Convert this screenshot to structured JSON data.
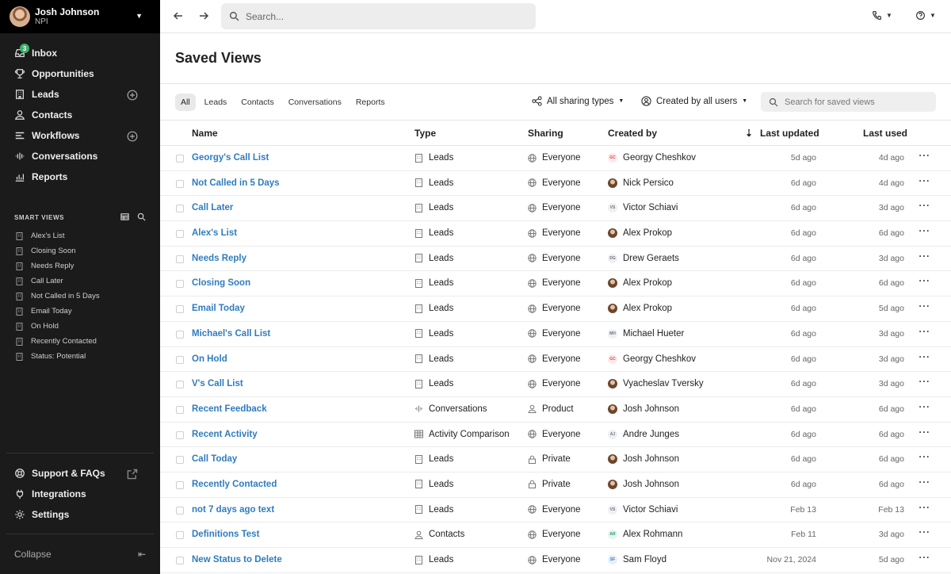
{
  "user": {
    "name": "Josh Johnson",
    "org": "NPI"
  },
  "nav": [
    {
      "label": "Inbox",
      "icon": "inbox-icon",
      "badge": "3"
    },
    {
      "label": "Opportunities",
      "icon": "trophy-icon"
    },
    {
      "label": "Leads",
      "icon": "building-icon"
    },
    {
      "label": "Contacts",
      "icon": "person-icon"
    },
    {
      "label": "Workflows",
      "icon": "workflow-icon"
    },
    {
      "label": "Conversations",
      "icon": "waveform-icon"
    },
    {
      "label": "Reports",
      "icon": "chart-icon"
    }
  ],
  "smart_views": {
    "heading": "SMART VIEWS",
    "items": [
      "Alex's List",
      "Closing Soon",
      "Needs Reply",
      "Call Later",
      "Not Called in 5 Days",
      "Email Today",
      "On Hold",
      "Recently Contacted",
      "Status: Potential"
    ]
  },
  "bottom_nav": [
    {
      "label": "Support & FAQs",
      "icon": "lifebuoy-icon"
    },
    {
      "label": "Integrations",
      "icon": "plug-icon"
    },
    {
      "label": "Settings",
      "icon": "gear-icon"
    }
  ],
  "collapse_label": "Collapse",
  "search": {
    "placeholder": "Search..."
  },
  "page_title": "Saved Views",
  "tabs": [
    "All",
    "Leads",
    "Contacts",
    "Conversations",
    "Reports"
  ],
  "filters": {
    "sharing": "All sharing types",
    "created_by": "Created by all users",
    "search_placeholder": "Search for saved views"
  },
  "columns": {
    "name": "Name",
    "type": "Type",
    "sharing": "Sharing",
    "created_by": "Created by",
    "last_updated": "Last updated",
    "last_used": "Last used"
  },
  "rows": [
    {
      "name": "Georgy's Call List",
      "type": "Leads",
      "sharing": "Everyone",
      "creator": "Georgy Cheshkov",
      "initials": "GC",
      "updated": "5d ago",
      "used": "4d ago"
    },
    {
      "name": "Not Called in 5 Days",
      "type": "Leads",
      "sharing": "Everyone",
      "creator": "Nick Persico",
      "initials": "",
      "updated": "6d ago",
      "used": "4d ago"
    },
    {
      "name": "Call Later",
      "type": "Leads",
      "sharing": "Everyone",
      "creator": "Victor Schiavi",
      "initials": "VS",
      "updated": "6d ago",
      "used": "3d ago"
    },
    {
      "name": "Alex's List",
      "type": "Leads",
      "sharing": "Everyone",
      "creator": "Alex Prokop",
      "initials": "",
      "updated": "6d ago",
      "used": "6d ago"
    },
    {
      "name": "Needs Reply",
      "type": "Leads",
      "sharing": "Everyone",
      "creator": "Drew Geraets",
      "initials": "DG",
      "updated": "6d ago",
      "used": "3d ago"
    },
    {
      "name": "Closing Soon",
      "type": "Leads",
      "sharing": "Everyone",
      "creator": "Alex Prokop",
      "initials": "",
      "updated": "6d ago",
      "used": "6d ago"
    },
    {
      "name": "Email Today",
      "type": "Leads",
      "sharing": "Everyone",
      "creator": "Alex Prokop",
      "initials": "",
      "updated": "6d ago",
      "used": "5d ago"
    },
    {
      "name": "Michael's Call List",
      "type": "Leads",
      "sharing": "Everyone",
      "creator": "Michael Hueter",
      "initials": "MH",
      "updated": "6d ago",
      "used": "3d ago"
    },
    {
      "name": "On Hold",
      "type": "Leads",
      "sharing": "Everyone",
      "creator": "Georgy Cheshkov",
      "initials": "GC",
      "updated": "6d ago",
      "used": "3d ago"
    },
    {
      "name": "V's Call List",
      "type": "Leads",
      "sharing": "Everyone",
      "creator": "Vyacheslav Tversky",
      "initials": "",
      "updated": "6d ago",
      "used": "3d ago"
    },
    {
      "name": "Recent Feedback",
      "type": "Conversations",
      "sharing": "Product",
      "creator": "Josh Johnson",
      "initials": "",
      "updated": "6d ago",
      "used": "6d ago"
    },
    {
      "name": "Recent Activity",
      "type": "Activity Comparison",
      "sharing": "Everyone",
      "creator": "Andre Junges",
      "initials": "AJ",
      "updated": "6d ago",
      "used": "6d ago"
    },
    {
      "name": "Call Today",
      "type": "Leads",
      "sharing": "Private",
      "creator": "Josh Johnson",
      "initials": "",
      "updated": "6d ago",
      "used": "6d ago"
    },
    {
      "name": "Recently Contacted",
      "type": "Leads",
      "sharing": "Private",
      "creator": "Josh Johnson",
      "initials": "",
      "updated": "6d ago",
      "used": "6d ago"
    },
    {
      "name": "not 7 days ago text",
      "type": "Leads",
      "sharing": "Everyone",
      "creator": "Victor Schiavi",
      "initials": "VS",
      "updated": "Feb 13",
      "used": "Feb 13"
    },
    {
      "name": "Definitions Test",
      "type": "Contacts",
      "sharing": "Everyone",
      "creator": "Alex Rohmann",
      "initials": "AR",
      "updated": "Feb 11",
      "used": "3d ago"
    },
    {
      "name": "New Status to Delete",
      "type": "Leads",
      "sharing": "Everyone",
      "creator": "Sam Floyd",
      "initials": "SF",
      "updated": "Nov 21, 2024",
      "used": "5d ago"
    }
  ]
}
